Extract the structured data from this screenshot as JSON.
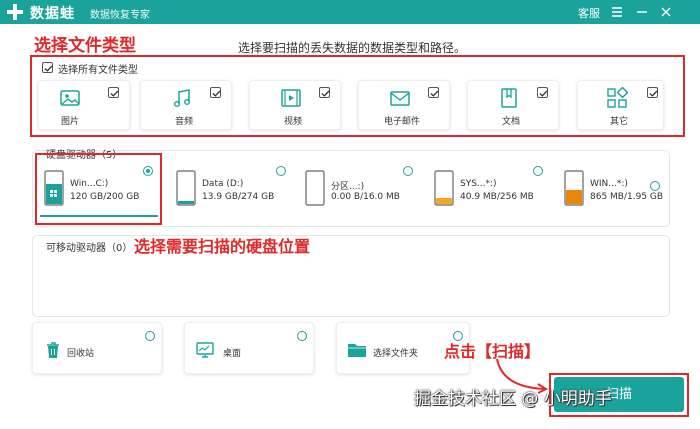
{
  "titlebar": {
    "app_name": "数据蛙",
    "subtitle": "数据恢复专家",
    "service_label": "客服",
    "icons": [
      "menu-icon",
      "minimize-icon",
      "close-icon"
    ],
    "bg_color": "#1aa39b"
  },
  "annotations": {
    "file_type_tip": "选择文件类型",
    "drive_tip": "选择需要扫描的硬盘位置",
    "scan_tip": "点击【扫描】",
    "color": "#e02a2a"
  },
  "hint": "选择要扫描的丢失数据的数据类型和路径。",
  "file_types": {
    "select_all_label": "选择所有文件类型",
    "select_all_checked": true,
    "items": [
      {
        "label": "图片",
        "icon": "picture-icon",
        "checked": true
      },
      {
        "label": "音频",
        "icon": "music-icon",
        "checked": true
      },
      {
        "label": "视频",
        "icon": "video-icon",
        "checked": true
      },
      {
        "label": "电子邮件",
        "icon": "email-icon",
        "checked": true
      },
      {
        "label": "文档",
        "icon": "document-icon",
        "checked": true
      },
      {
        "label": "其它",
        "icon": "other-icon",
        "checked": true
      }
    ]
  },
  "hard_drives": {
    "title": "硬盘驱动器（5）",
    "items": [
      {
        "name": "Win...C:)",
        "size": "120 GB/200 GB",
        "selected": true,
        "used_fraction": 0.6
      },
      {
        "name": "Data (D:)",
        "size": "13.9 GB/274 GB",
        "selected": false,
        "used_fraction": 0.05
      },
      {
        "name": "分区...:)",
        "size": "0.00  B/16.0 MB",
        "selected": false,
        "used_fraction": 0.0
      },
      {
        "name": "SYS...*:)",
        "size": "40.9 MB/256 MB",
        "selected": false,
        "used_fraction": 0.16
      },
      {
        "name": "WIN...*:)",
        "size": "865 MB/1.95 GB",
        "selected": false,
        "used_fraction": 0.44
      }
    ]
  },
  "removable_drives": {
    "title": "可移动驱动器（0）"
  },
  "shortcuts": [
    {
      "label": "回收站",
      "icon": "recycle-bin-icon"
    },
    {
      "label": "桌面",
      "icon": "desktop-icon"
    },
    {
      "label": "选择文件夹",
      "icon": "folder-icon"
    }
  ],
  "scan_button_label": "扫描",
  "watermark": "掘金技术社区 @ 小明助手"
}
